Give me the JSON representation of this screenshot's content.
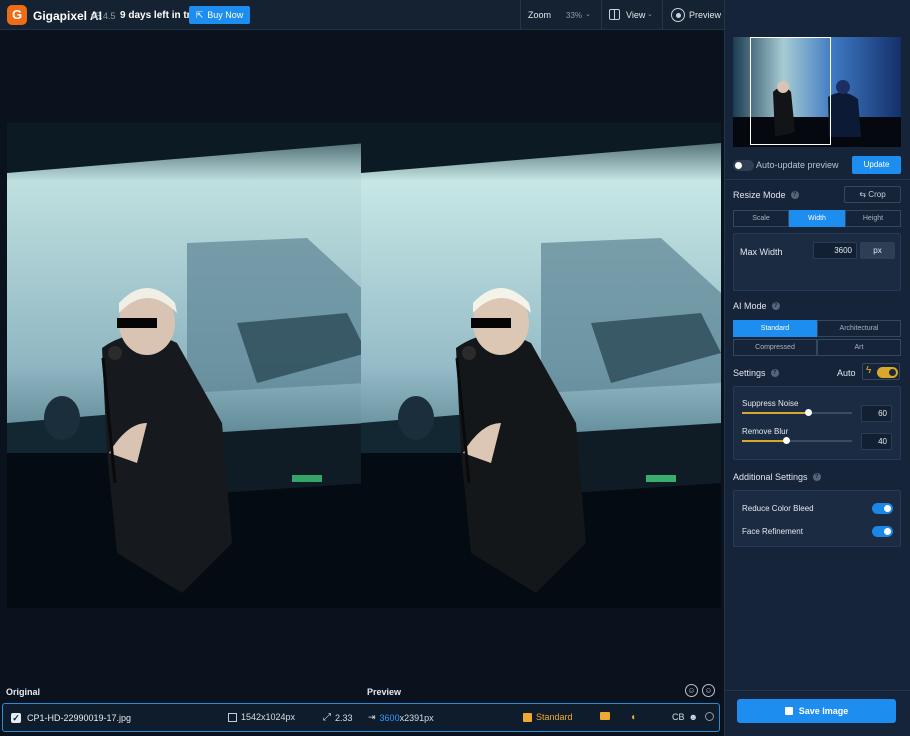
{
  "app": {
    "name": "Gigapixel AI",
    "version": "v5.4.5",
    "trial": "9 days left in trial",
    "buy_now": "Buy Now",
    "logo_letter": "G",
    "accent_color": "#1e8df0",
    "logo_color": "#ef6c17"
  },
  "toolbar": {
    "zoom_label": "Zoom",
    "zoom_value": "33%",
    "view_label": "View",
    "preview_label": "Preview"
  },
  "canvas": {
    "original_label": "Original",
    "preview_label": "Preview"
  },
  "file": {
    "name": "CP1-HD-22990019-17.jpg",
    "original_size": "1542x1024px",
    "scale": "2.33",
    "output_width": "3600",
    "output_rest": "x2391px",
    "model": "Standard",
    "tag": "CB"
  },
  "panel": {
    "auto_update_label": "Auto-update preview",
    "update_button": "Update",
    "resize_mode_title": "Resize Mode",
    "crop_label": "Crop",
    "resize_tabs": [
      "Scale",
      "Width",
      "Height"
    ],
    "resize_selected": "Width",
    "max_width_label": "Max Width",
    "max_width_value": "3600",
    "unit": "px",
    "ai_mode_title": "AI Mode",
    "ai_modes": [
      "Standard",
      "Architectural",
      "Compressed",
      "Art"
    ],
    "ai_selected": "Standard",
    "settings_title": "Settings",
    "auto_label": "Auto",
    "suppress_noise_label": "Suppress Noise",
    "suppress_noise_value": "60",
    "remove_blur_label": "Remove Blur",
    "remove_blur_value": "40",
    "additional_title": "Additional Settings",
    "reduce_color_bleed_label": "Reduce Color Bleed",
    "reduce_color_bleed_on": true,
    "face_refinement_label": "Face Refinement",
    "face_refinement_on": true,
    "save_button": "Save Image"
  }
}
